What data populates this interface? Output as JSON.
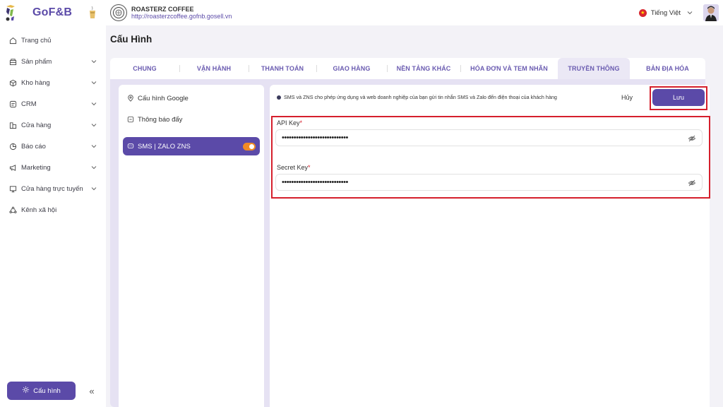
{
  "brand": {
    "name": "GoF&B"
  },
  "store": {
    "name": "ROASTERZ COFFEE",
    "url": "http://roasterzcoffee.gofnb.gosell.vn"
  },
  "language": {
    "label": "Tiếng Việt"
  },
  "sidebar": {
    "items": [
      {
        "label": "Trang chủ",
        "icon": "home-icon",
        "has_chevron": false
      },
      {
        "label": "Sản phẩm",
        "icon": "product-icon",
        "has_chevron": true
      },
      {
        "label": "Kho hàng",
        "icon": "box-icon",
        "has_chevron": true
      },
      {
        "label": "CRM",
        "icon": "crm-icon",
        "has_chevron": true
      },
      {
        "label": "Cửa hàng",
        "icon": "store-icon",
        "has_chevron": true
      },
      {
        "label": "Báo cáo",
        "icon": "report-icon",
        "has_chevron": true
      },
      {
        "label": "Marketing",
        "icon": "megaphone-icon",
        "has_chevron": true
      },
      {
        "label": "Cửa hàng trực tuyến",
        "icon": "online-store-icon",
        "has_chevron": true
      },
      {
        "label": "Kênh xã hội",
        "icon": "social-icon",
        "has_chevron": false
      }
    ],
    "config_button": "Cấu hình",
    "collapse_label": "«"
  },
  "page": {
    "title": "Cấu Hình"
  },
  "tabs": [
    {
      "label": "CHUNG",
      "active": false
    },
    {
      "label": "VẬN HÀNH",
      "active": false
    },
    {
      "label": "THANH TOÁN",
      "active": false
    },
    {
      "label": "GIAO HÀNG",
      "active": false
    },
    {
      "label": "NỀN TẢNG KHÁC",
      "active": false
    },
    {
      "label": "HÓA ĐƠN VÀ TEM NHÃN",
      "active": false
    },
    {
      "label": "TRUYỀN THÔNG",
      "active": true
    },
    {
      "label": "BẢN ĐỊA HÓA",
      "active": false
    }
  ],
  "left_menu": {
    "items": [
      {
        "label": "Cấu hình Google",
        "icon": "location-icon"
      },
      {
        "label": "Thông báo đẩy",
        "icon": "notification-icon"
      },
      {
        "label": "SMS | ZALO ZNS",
        "icon": "chat-icon",
        "active": true,
        "toggle_on": true
      }
    ]
  },
  "sms": {
    "description": "SMS và ZNS cho phép ứng dụng và web doanh nghiệp của bạn gửi tin nhắn SMS và Zalo đến điện thoại của khách hàng",
    "cancel_label": "Hủy",
    "save_label": "Lưu",
    "api_key_label": "API Key",
    "api_key_value": "••••••••••••••••••••••••••••",
    "secret_key_label": "Secret Key",
    "secret_key_value": "••••••••••••••••••••••••••••",
    "required_mark": "*"
  },
  "colors": {
    "accent": "#5b4aa8",
    "highlight_border": "#d51f2c",
    "toggle": "#f08a24",
    "background": "#f3f2f7"
  }
}
